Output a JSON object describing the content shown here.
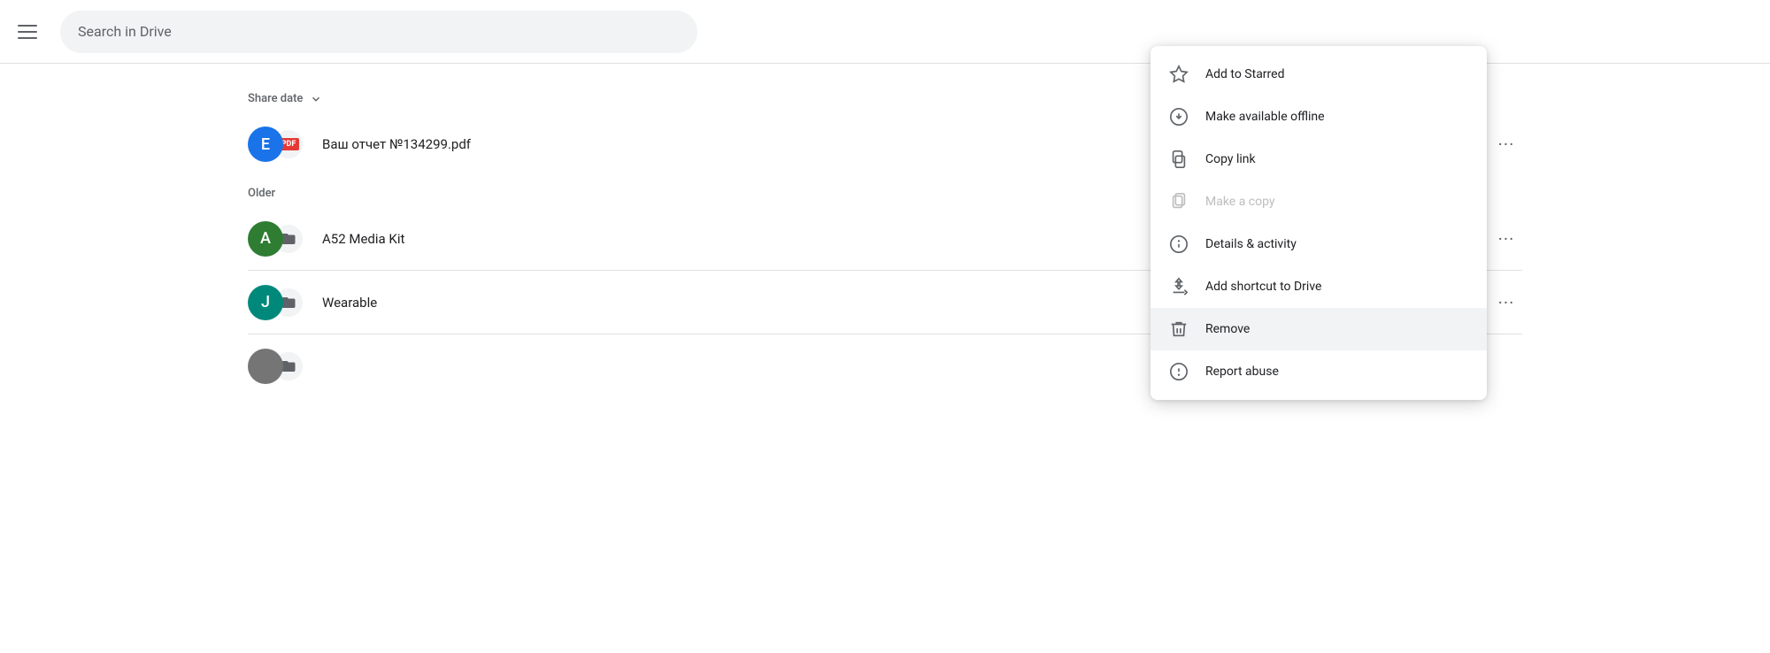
{
  "header": {
    "search_placeholder": "Search in Drive"
  },
  "sections": [
    {
      "id": "share-date",
      "label": "Share date",
      "has_arrow": true,
      "files": [
        {
          "id": "file-1",
          "name": "Ваш отчет №134299.pdf",
          "avatar_letter": "E",
          "avatar_color": "#1a73e8",
          "file_type": "pdf",
          "show_more": true
        }
      ]
    },
    {
      "id": "older",
      "label": "Older",
      "has_arrow": false,
      "files": [
        {
          "id": "file-2",
          "name": "A52 Media Kit",
          "avatar_letter": "A",
          "avatar_color": "#2e7d32",
          "file_type": "folder",
          "show_more": true
        },
        {
          "id": "file-3",
          "name": "Wearable",
          "avatar_letter": "J",
          "avatar_color": "#00897b",
          "file_type": "folder",
          "show_more": true
        },
        {
          "id": "file-4",
          "name": "",
          "avatar_letter": "",
          "avatar_color": "#757575",
          "file_type": "folder",
          "show_more": false
        }
      ]
    }
  ],
  "context_menu": {
    "items": [
      {
        "id": "add-starred",
        "label": "Add to Starred",
        "icon": "star",
        "disabled": false,
        "highlighted": false
      },
      {
        "id": "make-available-offline",
        "label": "Make available offline",
        "icon": "offline",
        "disabled": false,
        "highlighted": false
      },
      {
        "id": "copy-link",
        "label": "Copy link",
        "icon": "copy-link",
        "disabled": false,
        "highlighted": false
      },
      {
        "id": "make-a-copy",
        "label": "Make a copy",
        "icon": "make-copy",
        "disabled": true,
        "highlighted": false
      },
      {
        "id": "details-activity",
        "label": "Details & activity",
        "icon": "info",
        "disabled": false,
        "highlighted": false
      },
      {
        "id": "add-shortcut",
        "label": "Add shortcut to Drive",
        "icon": "shortcut",
        "disabled": false,
        "highlighted": false
      },
      {
        "id": "remove",
        "label": "Remove",
        "icon": "trash",
        "disabled": false,
        "highlighted": true
      },
      {
        "id": "report-abuse",
        "label": "Report abuse",
        "icon": "report",
        "disabled": false,
        "highlighted": false
      }
    ]
  }
}
